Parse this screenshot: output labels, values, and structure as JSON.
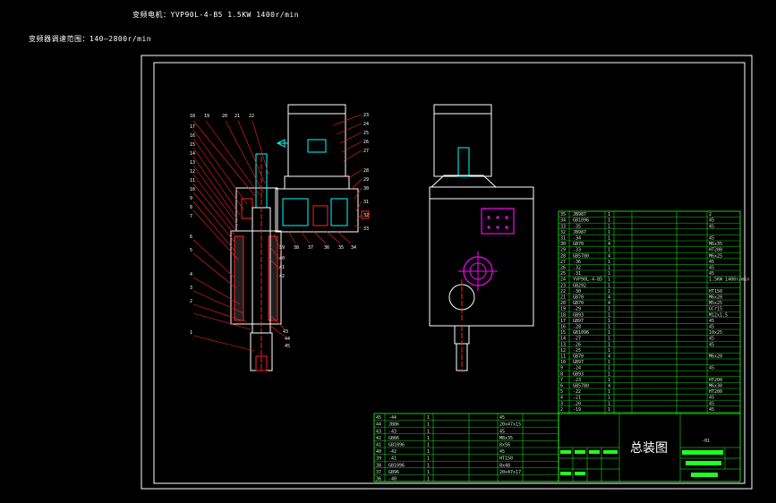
{
  "header": {
    "motor_line": "变频电机：YVP90L-4-B5  1.5KW  1400r/min",
    "speed_line": "变频器调速范围：140—2800r/min"
  },
  "title_block": {
    "drawing_title": "总装图",
    "drawing_code": "-01"
  },
  "callouts_left": [
    "18",
    "19",
    "20",
    "21",
    "22",
    "17",
    "16",
    "15",
    "14",
    "13",
    "12",
    "11",
    "10",
    "9",
    "8",
    "7",
    "6",
    "5",
    "4",
    "3",
    "2",
    "1"
  ],
  "callouts_right": [
    "23",
    "24",
    "25",
    "26",
    "27",
    "28",
    "29",
    "30",
    "31",
    "32",
    "33",
    "34",
    "35",
    "36",
    "37",
    "38",
    "39",
    "40",
    "41",
    "42",
    "43",
    "44",
    "45"
  ],
  "bom_right": {
    "rows": [
      {
        "no": "35",
        "code": "JB987",
        "qty": "1",
        "note": "2"
      },
      {
        "no": "34",
        "code": "GB1096",
        "qty": "1",
        "note": "45"
      },
      {
        "no": "33",
        "code": "-35",
        "qty": "1",
        "note": "45"
      },
      {
        "no": "32",
        "code": "JB987",
        "qty": "1",
        "note": ""
      },
      {
        "no": "31",
        "code": "-34",
        "qty": "1",
        "note": "45"
      },
      {
        "no": "30",
        "code": "GB70",
        "qty": "4",
        "note": "M6x35"
      },
      {
        "no": "29",
        "code": "-33",
        "qty": "1",
        "note": "HT200"
      },
      {
        "no": "28",
        "code": "GB5780",
        "qty": "4",
        "note": "M6x25"
      },
      {
        "no": "27",
        "code": "-36",
        "qty": "1",
        "note": "45"
      },
      {
        "no": "26",
        "code": "-32",
        "qty": "1",
        "note": "45"
      },
      {
        "no": "25",
        "code": "-31",
        "qty": "1",
        "note": "45"
      },
      {
        "no": "24",
        "code": "YVP90L-4-B5",
        "qty": "1",
        "note": "1.5KW 1400r/min"
      },
      {
        "no": "23",
        "code": "GB292",
        "qty": "1",
        "note": ""
      },
      {
        "no": "22",
        "code": "-30",
        "qty": "1",
        "note": "HT150"
      },
      {
        "no": "21",
        "code": "GB70",
        "qty": "4",
        "note": "M6x20"
      },
      {
        "no": "20",
        "code": "GB70",
        "qty": "4",
        "note": "M5x25"
      },
      {
        "no": "19",
        "code": "-29",
        "qty": "1",
        "note": "GCr15"
      },
      {
        "no": "18",
        "code": "GB93",
        "qty": "1",
        "note": "M12x1.5"
      },
      {
        "no": "17",
        "code": "GB97",
        "qty": "1",
        "note": "45"
      },
      {
        "no": "16",
        "code": "-28",
        "qty": "1",
        "note": "45"
      },
      {
        "no": "15",
        "code": "GB1096",
        "qty": "1",
        "note": "10x25"
      },
      {
        "no": "14",
        "code": "-27",
        "qty": "1",
        "note": "45"
      },
      {
        "no": "13",
        "code": "-26",
        "qty": "1",
        "note": "45"
      },
      {
        "no": "12",
        "code": "-25",
        "qty": "1",
        "note": ""
      },
      {
        "no": "11",
        "code": "GB70",
        "qty": "4",
        "note": "M6x20"
      },
      {
        "no": "10",
        "code": "GB97",
        "qty": "1",
        "note": ""
      },
      {
        "no": "9",
        "code": "-24",
        "qty": "1",
        "note": "45"
      },
      {
        "no": "8",
        "code": "GB93",
        "qty": "1",
        "note": ""
      },
      {
        "no": "7",
        "code": "-23",
        "qty": "1",
        "note": "HT200"
      },
      {
        "no": "6",
        "code": "GB5780",
        "qty": "4",
        "note": "M6x30"
      },
      {
        "no": "5",
        "code": "-22",
        "qty": "1",
        "note": "HT200"
      },
      {
        "no": "4",
        "code": "-21",
        "qty": "1",
        "note": "45"
      },
      {
        "no": "3",
        "code": "-20",
        "qty": "1",
        "note": "45"
      },
      {
        "no": "2",
        "code": "-19",
        "qty": "1",
        "note": "45"
      }
    ]
  },
  "bom_bottom": {
    "rows": [
      {
        "no": "45",
        "code": "-44",
        "qty": "1",
        "note": "45"
      },
      {
        "no": "44",
        "code": "JB86",
        "qty": "1",
        "note": "20x47x15"
      },
      {
        "no": "43",
        "code": "-43",
        "qty": "1",
        "note": "45"
      },
      {
        "no": "42",
        "code": "GB86",
        "qty": "1",
        "note": "M8x35"
      },
      {
        "no": "41",
        "code": "GB1096",
        "qty": "1",
        "note": "8x56"
      },
      {
        "no": "40",
        "code": "-42",
        "qty": "1",
        "note": "45"
      },
      {
        "no": "39",
        "code": "-41",
        "qty": "1",
        "note": "HT150"
      },
      {
        "no": "38",
        "code": "GB1096",
        "qty": "1",
        "note": "8x48"
      },
      {
        "no": "37",
        "code": "GB96",
        "qty": "1",
        "note": "20x47x17"
      },
      {
        "no": "36",
        "code": "-40",
        "qty": "1",
        "note": ""
      }
    ]
  },
  "colors": {
    "background": "#000000",
    "frame": "#ffffff",
    "table_lines": "#20ff20",
    "red_lines": "#ff2020",
    "cyan_lines": "#00ffff",
    "magenta": "#ff00ff",
    "motor_body": "#ffffff"
  }
}
